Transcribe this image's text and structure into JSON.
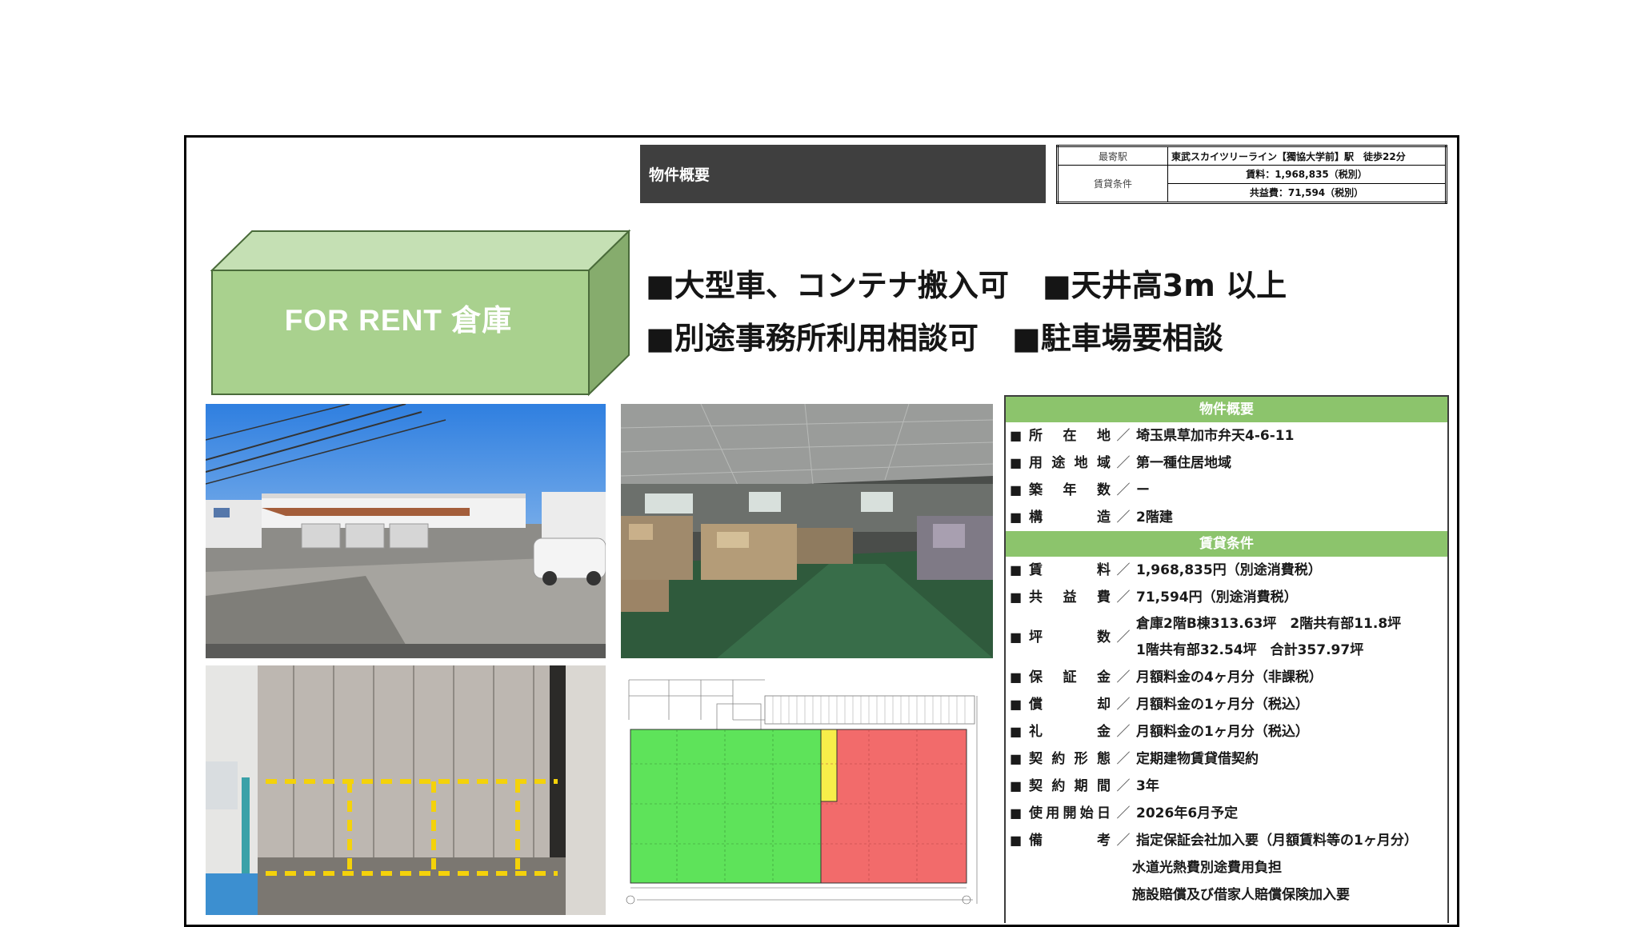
{
  "header": {
    "title": "物件概要"
  },
  "top_table": {
    "station_label": "最寄駅",
    "station_value": "東武スカイツリーライン【獨協大学前】駅　徒歩22分",
    "terms_label": "賃貸条件",
    "rent_value": "賃料：1,968,835（税別）",
    "common_value": "共益費：71,594（税別）"
  },
  "banner": {
    "label": "FOR RENT 倉庫"
  },
  "features": {
    "row1": [
      "■大型車、コンテナ搬入可",
      "■天井高3m 以上"
    ],
    "row2": [
      "■別途事務所利用相談可",
      "■駐車場要相談"
    ]
  },
  "overview": {
    "heading": "物件概要",
    "items": [
      {
        "key": [
          "所",
          "在",
          "地"
        ],
        "value": "埼玉県草加市弁天4-6-11"
      },
      {
        "key": [
          "用",
          "途",
          "地",
          "域"
        ],
        "value": "第一種住居地域"
      },
      {
        "key": [
          "築",
          "年",
          "数"
        ],
        "value": "ー"
      },
      {
        "key": [
          "構",
          "造"
        ],
        "value": "2階建"
      }
    ]
  },
  "terms": {
    "heading": "賃貸条件",
    "rent": {
      "key": [
        "賃",
        "料"
      ],
      "value": "1,968,835円（別途消費税）"
    },
    "common": {
      "key": [
        "共",
        "益",
        "費"
      ],
      "value": "71,594円（別途消費税）"
    },
    "area": {
      "key": [
        "坪",
        "数"
      ],
      "value_line1": "倉庫2階B棟313.63坪　2階共有部11.8坪",
      "value_line2": "1階共有部32.54坪　合計357.97坪"
    },
    "items": [
      {
        "key": [
          "保",
          "証",
          "金"
        ],
        "value": "月額料金の4ヶ月分（非課税）"
      },
      {
        "key": [
          "償",
          "却"
        ],
        "value": "月額料金の1ヶ月分（税込）"
      },
      {
        "key": [
          "礼",
          "金"
        ],
        "value": "月額料金の1ヶ月分（税込）"
      },
      {
        "key": [
          "契",
          "約",
          "形",
          "態"
        ],
        "value": "定期建物賃貸借契約"
      },
      {
        "key": [
          "契",
          "約",
          "期",
          "間"
        ],
        "value": "3年"
      },
      {
        "key": [
          "使",
          "用",
          "開",
          "始",
          "日"
        ],
        "value": "2026年6月予定"
      }
    ],
    "remarks": {
      "key": [
        "備",
        "考"
      ],
      "line1": "指定保証会社加入要（月額賃料等の1ヶ月分）",
      "line2": "水道光熱費別途費用負担",
      "line3": "施設賠償及び借家人賠償保険加入要"
    },
    "separator": "／",
    "bullet": "■"
  },
  "colors": {
    "green_box_front": "#a9d18e",
    "green_panel_header": "#8cc46c",
    "header_bar": "#3f3f3f",
    "floorplan_green": "#5ee35a",
    "floorplan_red": "#f26b6b",
    "floorplan_yellow": "#f7ee4a"
  }
}
